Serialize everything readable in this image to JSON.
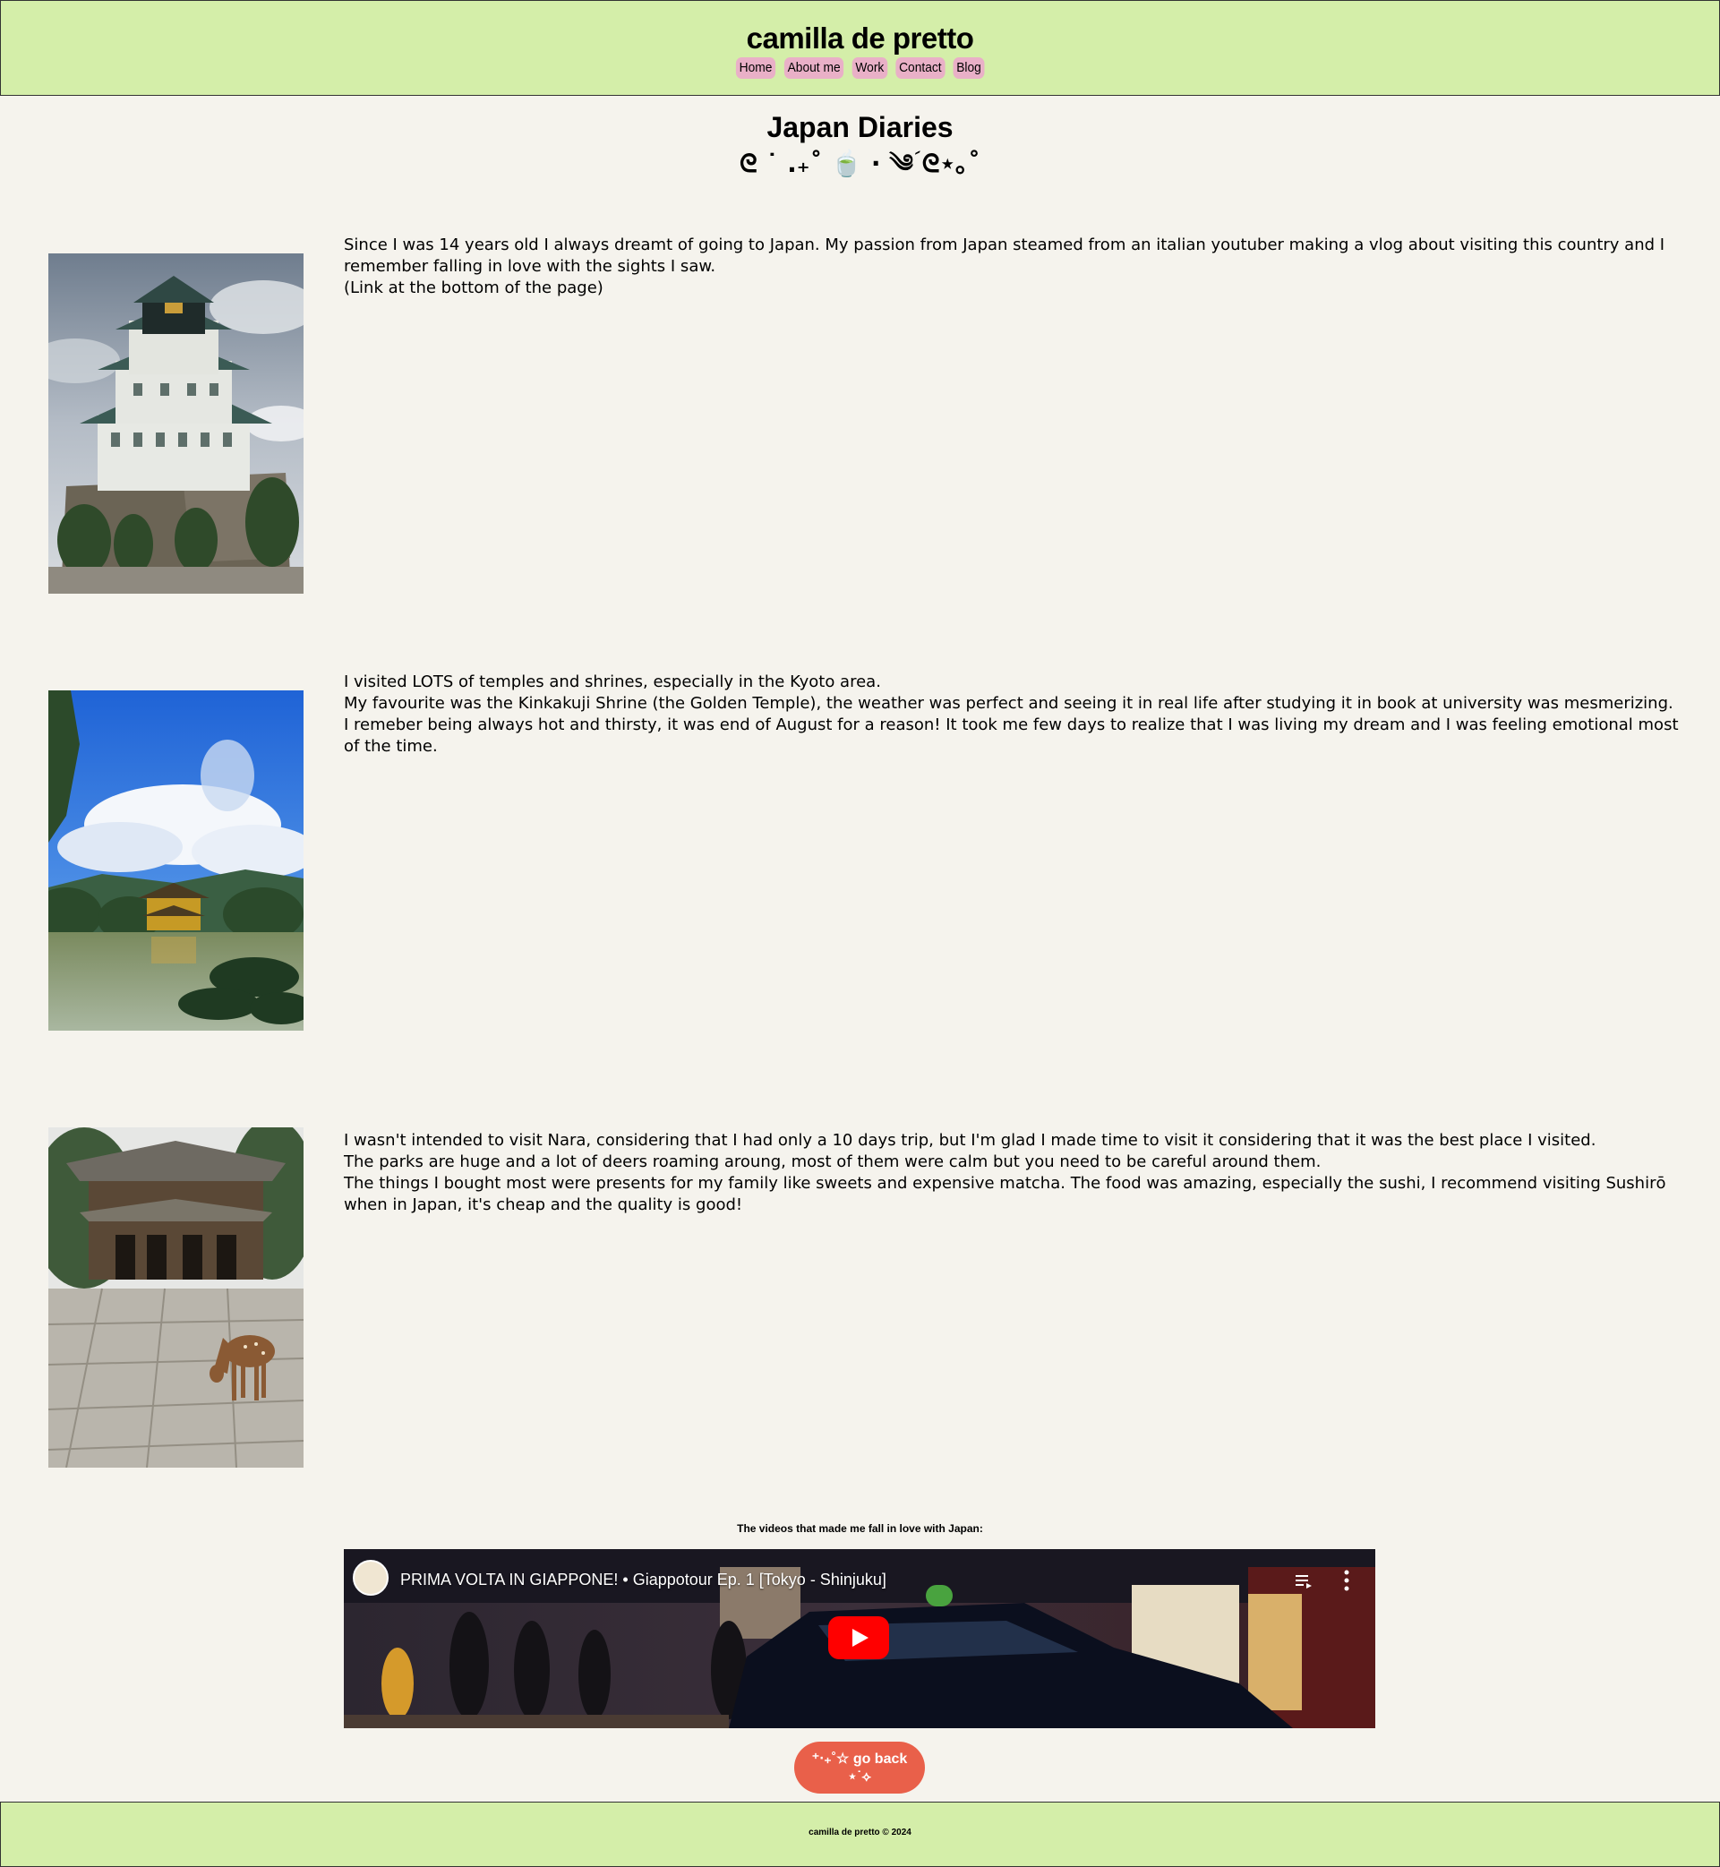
{
  "header": {
    "site_title": "camilla de pretto",
    "nav": [
      "Home",
      "About me",
      "Work",
      "Contact",
      "Blog"
    ]
  },
  "page": {
    "title": "Japan Diaries",
    "decoration": "ᘓ ˙ .₊˚ 🍵 · ༄ؘ ᘓ⋆｡˚"
  },
  "entries": [
    {
      "image_alt": "Osaka castle photo",
      "paragraphs": [
        "Since I was 14 years old I always dreamt of going to Japan. My passion from Japan steamed from an italian youtuber making a vlog about visiting this country and I remember falling in love with the sights I saw.",
        "(Link at the bottom of the page)"
      ]
    },
    {
      "image_alt": "Kinkakuji golden temple photo",
      "paragraphs": [
        "I visited LOTS of temples and shrines, especially in the Kyoto area.",
        "My favourite was the Kinkakuji Shrine (the Golden Temple), the weather was perfect and seeing it in real life after studying it in book at university was mesmerizing.",
        "I remeber being always hot and thirsty, it was end of August for a reason! It took me few days to realize that I was living my dream and I was feeling emotional most of the time."
      ]
    },
    {
      "image_alt": "Nara temple gate with deer photo",
      "paragraphs": [
        "I wasn't intended to visit Nara, considering that I had only a 10 days trip, but I'm glad I made time to visit it considering that it was the best place I visited.",
        "The parks are huge and a lot of deers roaming aroung, most of them were calm but you need to be careful around them.",
        "The things I bought most were presents for my family like sweets and expensive matcha. The food was amazing, especially the sushi, I recommend visiting Sushirō when in Japan, it's cheap and the quality is good!"
      ]
    }
  ],
  "videos": {
    "heading": "The videos that made me fall in love with Japan:",
    "video_title": "PRIMA VOLTA IN GIAPPONE! • Giappotour Ep. 1 [Tokyo - Shinjuku]"
  },
  "go_back_label": "⁺‧₊˚☆ go back ⋆˙⟡",
  "footer": {
    "text": "camilla de pretto © 2024"
  },
  "colors": {
    "background": "#f5f3ed",
    "header_bg": "#d4eea9",
    "nav_pill": "#e9b0c7",
    "go_back_bg": "#e9604a",
    "youtube_red": "#ff0000"
  },
  "icons": {
    "play": "youtube-play-icon",
    "queue": "playlist-queue-icon",
    "more": "more-vertical-icon",
    "avatar": "channel-avatar"
  }
}
